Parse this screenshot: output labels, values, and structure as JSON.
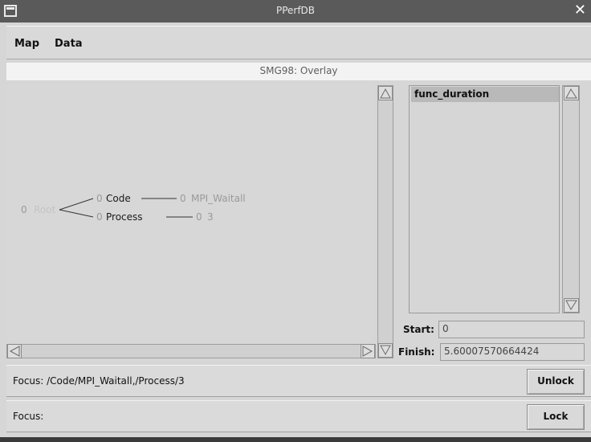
{
  "window": {
    "title": "PPerfDB",
    "close_glyph": "✕"
  },
  "menu": {
    "items": [
      "Map",
      "Data"
    ]
  },
  "view": {
    "subtitle": "SMG98: Overlay"
  },
  "tree": {
    "root_value": "0",
    "root_label": "Root",
    "children": [
      {
        "value": "0",
        "label": "Code",
        "leaf_value": "0",
        "leaf_label": "MPI_Waitall"
      },
      {
        "value": "0",
        "label": "Process",
        "leaf_value": "0",
        "leaf_label": "3"
      }
    ]
  },
  "metrics": {
    "items": [
      "func_duration"
    ]
  },
  "range": {
    "start_label": "Start:",
    "start_value": "0",
    "finish_label": "Finish:",
    "finish_value": "5.60007570664424"
  },
  "focus1": {
    "text": "Focus: /Code/MPI_Waitall,/Process/3",
    "button": "Unlock"
  },
  "focus2": {
    "text": "Focus:",
    "button": "Lock"
  }
}
